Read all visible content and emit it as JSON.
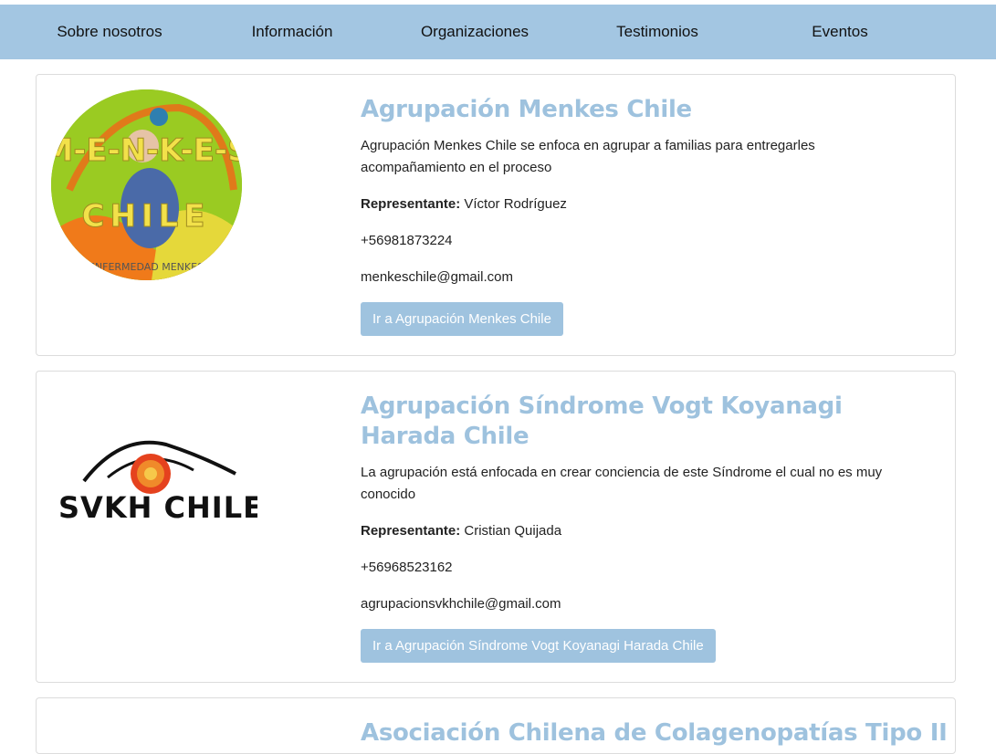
{
  "nav": {
    "items": [
      "Sobre nosotros",
      "Información",
      "Organizaciones",
      "Testimonios",
      "Eventos"
    ]
  },
  "orgs": [
    {
      "title": "Agrupación Menkes Chile",
      "description": "Agrupación Menkes Chile se enfoca en agrupar a familias para entregarles acompañamiento en el proceso",
      "rep_label": "Representante:",
      "rep_name": "Víctor Rodríguez",
      "phone": "+56981873224",
      "email": "menkeschile@gmail.com",
      "button": "Ir a Agrupación Menkes Chile",
      "logo_text": "M-E-N-K-E-S",
      "logo_subtext": "CHILE",
      "logo_caption": "ENFERMEDAD MENKES"
    },
    {
      "title": "Agrupación Síndrome Vogt Koyanagi Harada Chile",
      "description": "La agrupación está enfocada en crear conciencia de este Síndrome el cual no es muy conocido",
      "rep_label": "Representante:",
      "rep_name": "Cristian Quijada",
      "phone": "+56968523162",
      "email": "agrupacionsvkhchile@gmail.com",
      "button": "Ir a Agrupación Síndrome Vogt Koyanagi Harada Chile",
      "logo_text": "SVKH CHILE"
    },
    {
      "title": "Asociación Chilena de Colagenopatías Tipo II"
    }
  ],
  "colors": {
    "nav_bg": "#a3c6e2",
    "title": "#9ec2de",
    "button_bg": "#9fc3df"
  }
}
